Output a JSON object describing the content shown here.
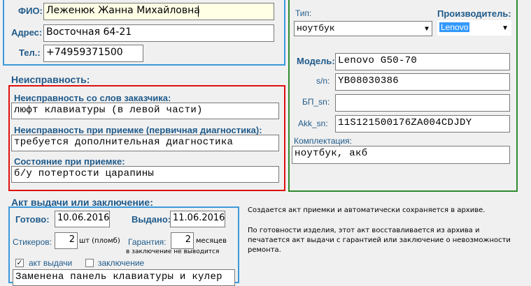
{
  "client": {
    "fio_label": "ФИО:",
    "fio_value": "Леженюк Жанна Михайловна",
    "address_label": "Адрес:",
    "address_value": "Восточная 64-21",
    "phone_label": "Тел.:",
    "phone_value": "+74959371500"
  },
  "device": {
    "type_label": "Тип:",
    "type_value": "ноутбук",
    "maker_label": "Производитель:",
    "maker_value": "Lenovo",
    "model_label": "Модель:",
    "model_value": "Lenovo G50-70",
    "sn_label": "s/n:",
    "sn_value": "YB08030386",
    "bp_label": "БП_sn:",
    "bp_value": "",
    "akk_label": "Akk_sn:",
    "akk_value": "11S121500176ZA004CDJDY",
    "kit_label": "Комплектация:",
    "kit_value": "ноутбук, акб"
  },
  "fault": {
    "section_title": "Неисправность:",
    "customer_label": "Неисправность со слов заказчика:",
    "customer_value": "люфт клавиатуры (в левой части)",
    "intake_label": "Неисправность при приемке (первичная диагностика):",
    "intake_value": "требуется дополнительная диагностика",
    "condition_label": "Состояние при приемке:",
    "condition_value": "б/у потертости царапины"
  },
  "act": {
    "section_title": "Акт выдачи или заключение:",
    "ready_label": "Готово:",
    "ready_value": "10.06.2016",
    "issued_label": "Выдано:",
    "issued_value": "11.06.2016",
    "stickers_label": "Стикеров:",
    "stickers_value": "2",
    "stickers_unit": "шт (пломб)",
    "warranty_label": "Гарантия:",
    "warranty_value": "2",
    "warranty_unit": "месяцев",
    "warranty_note": "в заключение не выводится",
    "act_checkbox_label": "акт выдачи",
    "act_checkbox_checked": true,
    "conclusion_checkbox_label": "заключение",
    "conclusion_checkbox_checked": false,
    "result_value": "Заменена панель клавиатуры и кулер"
  },
  "info": {
    "line1": "Создается акт приемки и автоматически сохраняется в архиве.",
    "line2": "По готовности изделия, этот акт восставливается из архива и",
    "line3": "печатается акт выдачи с гарантией или заключение о невозможности",
    "line4": "ремонта."
  },
  "colors": {
    "label_blue": "#1f5a8a",
    "client_border": "#3b9ad9",
    "fault_border": "#e01010",
    "device_border": "#2e8b2e",
    "fio_bg": "#ffffe6",
    "selection_blue": "#3399ff"
  }
}
